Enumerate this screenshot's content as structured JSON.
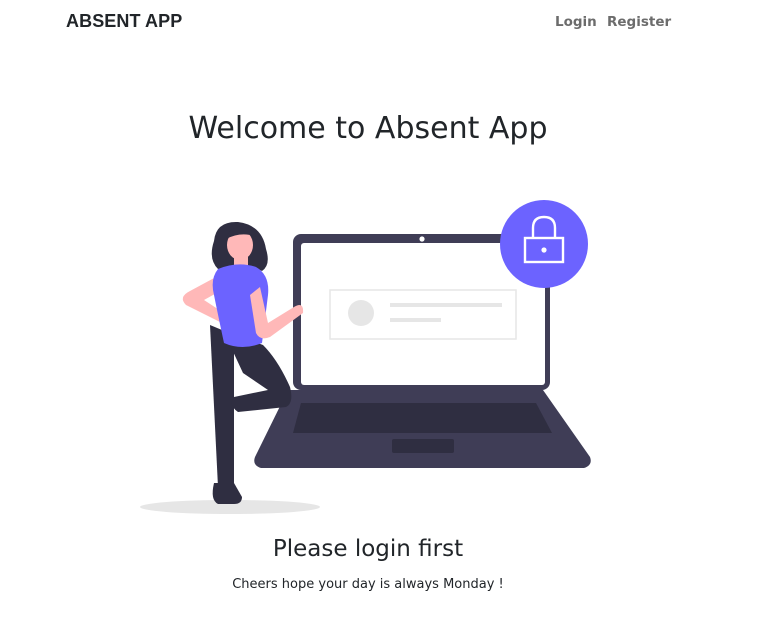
{
  "navbar": {
    "brand": "ABSENT APP",
    "links": [
      {
        "label": "Login"
      },
      {
        "label": "Register"
      }
    ]
  },
  "main": {
    "title": "Welcome to Absent App",
    "subtitle": "Please login first",
    "tagline": "Cheers hope your day is always Monday !"
  },
  "illustration": {
    "icon": "lock-icon",
    "colors": {
      "accent": "#6c63ff",
      "laptop": "#3f3d56",
      "laptop_keyboard": "#2f2e41",
      "skin": "#ffb8b8",
      "hair": "#2f2e41",
      "shadow": "#e6e6e6"
    }
  }
}
